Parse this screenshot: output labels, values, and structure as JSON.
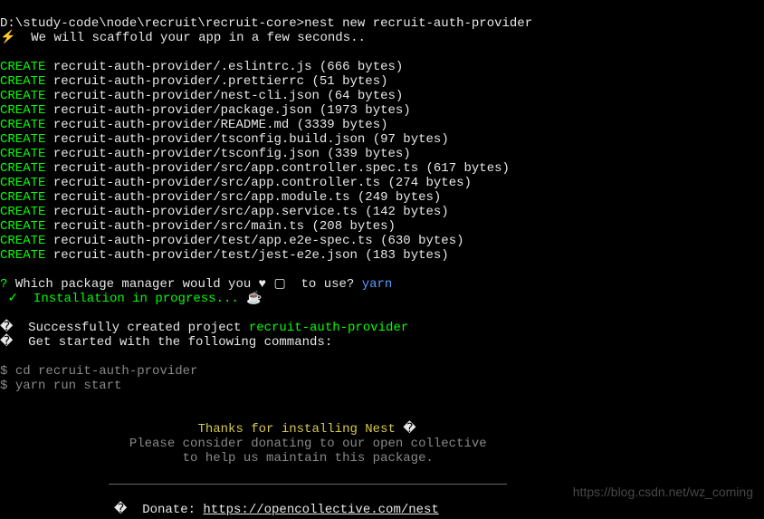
{
  "prompt": {
    "path": "D:\\study-code\\node\\recruit\\recruit-core>",
    "command": "nest new recruit-auth-provider"
  },
  "scaffold_msg": "⚡  We will scaffold your app in a few seconds..",
  "creates": [
    {
      "label": "CREATE",
      "file": "recruit-auth-provider/.eslintrc.js",
      "size": "(666 bytes)"
    },
    {
      "label": "CREATE",
      "file": "recruit-auth-provider/.prettierrc",
      "size": "(51 bytes)"
    },
    {
      "label": "CREATE",
      "file": "recruit-auth-provider/nest-cli.json",
      "size": "(64 bytes)"
    },
    {
      "label": "CREATE",
      "file": "recruit-auth-provider/package.json",
      "size": "(1973 bytes)"
    },
    {
      "label": "CREATE",
      "file": "recruit-auth-provider/README.md",
      "size": "(3339 bytes)"
    },
    {
      "label": "CREATE",
      "file": "recruit-auth-provider/tsconfig.build.json",
      "size": "(97 bytes)"
    },
    {
      "label": "CREATE",
      "file": "recruit-auth-provider/tsconfig.json",
      "size": "(339 bytes)"
    },
    {
      "label": "CREATE",
      "file": "recruit-auth-provider/src/app.controller.spec.ts",
      "size": "(617 bytes)"
    },
    {
      "label": "CREATE",
      "file": "recruit-auth-provider/src/app.controller.ts",
      "size": "(274 bytes)"
    },
    {
      "label": "CREATE",
      "file": "recruit-auth-provider/src/app.module.ts",
      "size": "(249 bytes)"
    },
    {
      "label": "CREATE",
      "file": "recruit-auth-provider/src/app.service.ts",
      "size": "(142 bytes)"
    },
    {
      "label": "CREATE",
      "file": "recruit-auth-provider/src/main.ts",
      "size": "(208 bytes)"
    },
    {
      "label": "CREATE",
      "file": "recruit-auth-provider/test/app.e2e-spec.ts",
      "size": "(630 bytes)"
    },
    {
      "label": "CREATE",
      "file": "recruit-auth-provider/test/jest-e2e.json",
      "size": "(183 bytes)"
    }
  ],
  "question": {
    "prefix": "?",
    "text": "Which package manager would you ♥ ▢  to use?",
    "answer": "yarn"
  },
  "install_progress": " ✓  Installation in progress... ☕",
  "success": {
    "bullet": "�",
    "prefix": "  Successfully created project ",
    "project": "recruit-auth-provider"
  },
  "get_started": {
    "bullet": "�",
    "text": "  Get started with the following commands:"
  },
  "commands": [
    {
      "prompt": "$ ",
      "cmd": "cd recruit-auth-provider"
    },
    {
      "prompt": "$ ",
      "cmd": "yarn run start"
    }
  ],
  "thanks": {
    "title": "Thanks for installing Nest ",
    "emoji": "�",
    "line1": "Please consider donating to our open collective",
    "line2": "to help us maintain this package."
  },
  "donate": {
    "bullet": "�",
    "label": "  Donate: ",
    "url": "https://opencollective.com/nest"
  },
  "watermark": "https://blog.csdn.net/wz_coming"
}
